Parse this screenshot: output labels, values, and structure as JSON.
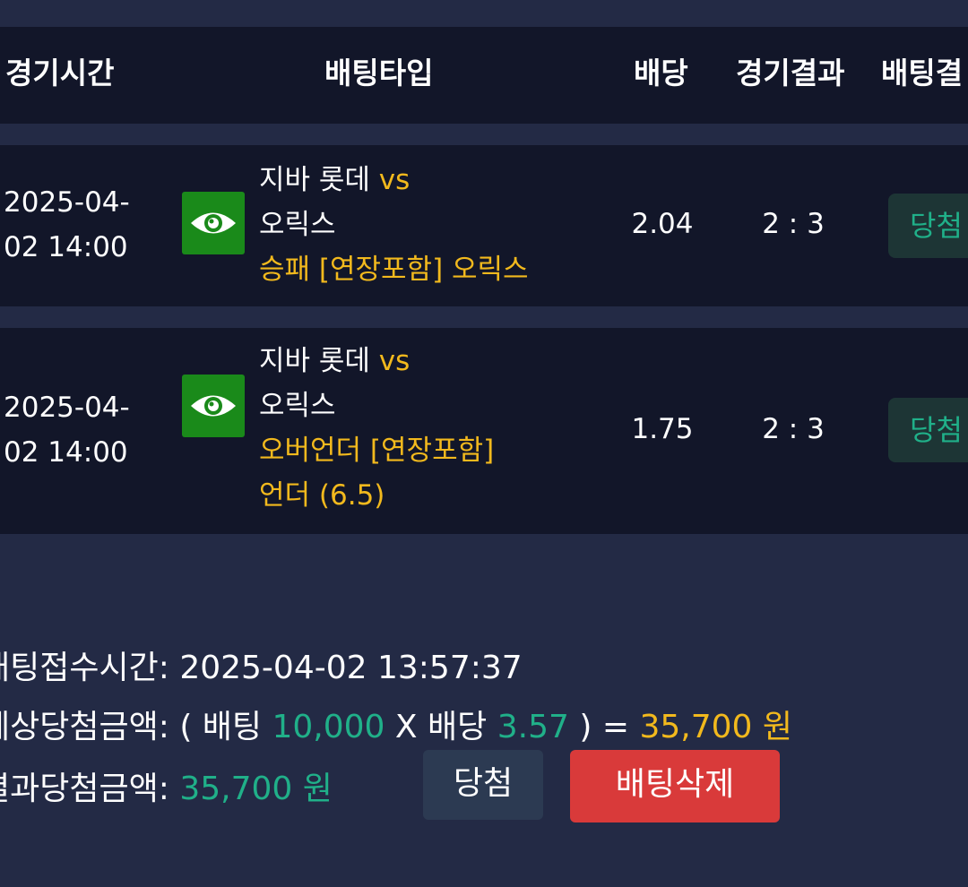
{
  "header": {
    "col_time": "경기시간",
    "col_type": "배팅타입",
    "col_odds": "배당",
    "col_score": "경기결과",
    "col_result": "배팅결"
  },
  "rows": [
    {
      "date_line1": "2025-04-",
      "date_line2": "02 14:00",
      "team_home": "지바 롯데",
      "vs": "vs",
      "team_away": "오릭스",
      "bet_line1": "승패 [연장포함] 오릭스",
      "bet_line2": "",
      "odds": "2.04",
      "score": "2 : 3",
      "result": "당첨",
      "icon": "eye-icon"
    },
    {
      "date_line1": "2025-04-",
      "date_line2": "02 14:00",
      "team_home": "지바 롯데",
      "vs": "vs",
      "team_away": "오릭스",
      "bet_line1": "오버언더 [연장포함]",
      "bet_line2": "언더 (6.5)",
      "odds": "1.75",
      "score": "2 : 3",
      "result": "당첨",
      "icon": "eye-icon"
    }
  ],
  "summary": {
    "time_label": "배팅접수시간:",
    "time_value": "2025-04-02 13:57:37",
    "expected_label": "예상당첨금액:",
    "expected_open": "( 배팅",
    "bet_amount": "10,000",
    "times": "X 배당",
    "total_odds": "3.57",
    "expected_close": ") =",
    "expected_win": "35,700 원",
    "actual_label": "결과당첨금액:",
    "actual_win": "35,700 원",
    "win_button": "당첨",
    "delete_button": "배팅삭제"
  },
  "colors": {
    "background": "#232a45",
    "panel": "#121629",
    "accent_yellow": "#f2b91d",
    "accent_green": "#20b089",
    "delete_red": "#d93a3a"
  }
}
